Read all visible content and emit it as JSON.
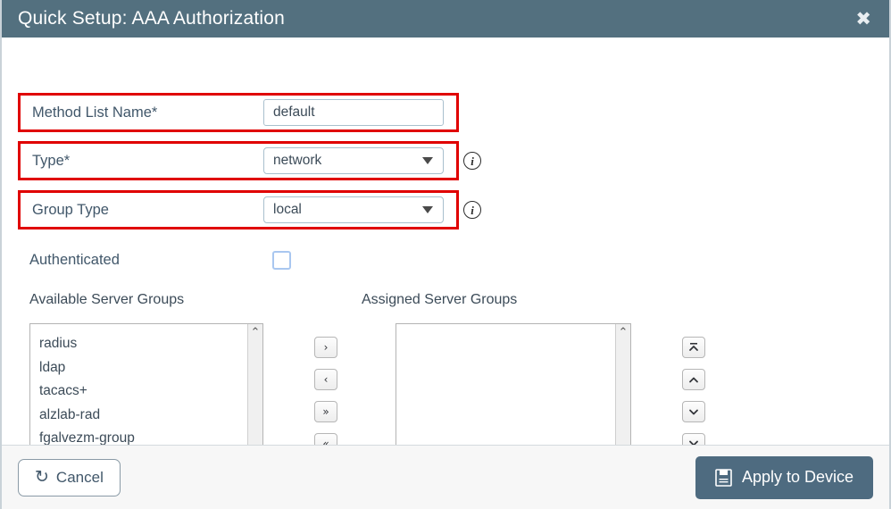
{
  "dialog": {
    "title": "Quick Setup: AAA Authorization",
    "close_label": "✖",
    "accent_color": "#53707f",
    "highlight_color": "#e00000"
  },
  "form": {
    "method_list": {
      "label": "Method List Name*",
      "value": "default",
      "placeholder": ""
    },
    "type": {
      "label": "Type*",
      "value": "network",
      "info_icon": "info-icon"
    },
    "group_type": {
      "label": "Group Type",
      "value": "local",
      "info_icon": "info-icon"
    },
    "authenticated": {
      "label": "Authenticated",
      "checked": false
    }
  },
  "server_groups": {
    "available_label": "Available Server Groups",
    "assigned_label": "Assigned Server Groups",
    "available_items": [
      "radius",
      "ldap",
      "tacacs+",
      "alzlab-rad",
      "fgalvezm-group"
    ],
    "assigned_items": [],
    "transfer_buttons": [
      {
        "name": "move-right-button",
        "glyph": "›"
      },
      {
        "name": "move-left-button",
        "glyph": "‹"
      },
      {
        "name": "move-all-right-button",
        "glyph": "»"
      },
      {
        "name": "move-all-left-button",
        "glyph": "«"
      }
    ],
    "order_buttons": [
      {
        "name": "move-to-top-button",
        "glyph": "top"
      },
      {
        "name": "move-up-button",
        "glyph": "up"
      },
      {
        "name": "move-down-button",
        "glyph": "down"
      },
      {
        "name": "move-to-bottom-button",
        "glyph": "bottom"
      }
    ],
    "scroll_up": "⌃",
    "scroll_down": "⌄"
  },
  "footer": {
    "cancel_label": "Cancel",
    "cancel_icon": "undo-icon",
    "apply_label": "Apply to Device",
    "apply_icon": "save-icon",
    "apply_color": "#4e6b80"
  }
}
